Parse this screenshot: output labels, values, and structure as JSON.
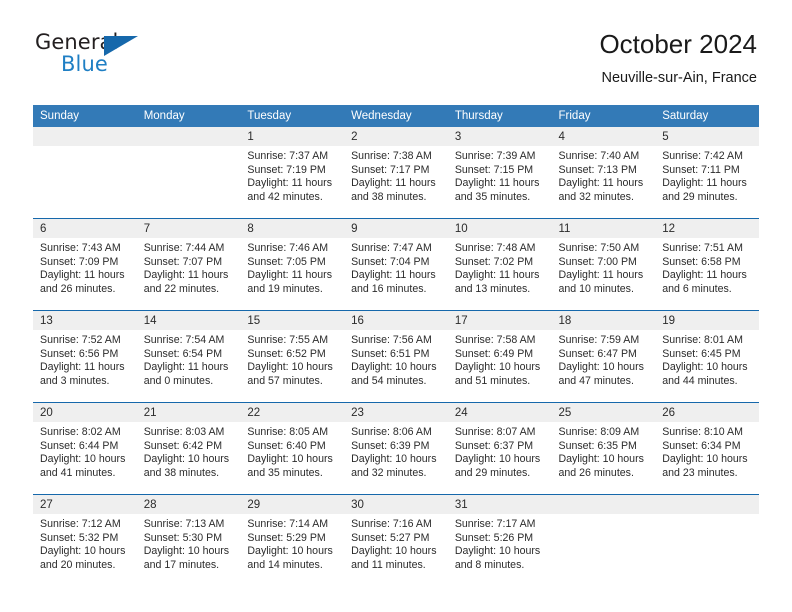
{
  "brand": {
    "name_part1": "General",
    "name_part2": "Blue",
    "logo_icon": "triangle-logo-icon",
    "accent_color": "#1668ab"
  },
  "header": {
    "title": "October 2024",
    "subtitle": "Neuville-sur-Ain, France",
    "header_bg_color": "#337ab7",
    "row_divider_color": "#1668ab",
    "daynum_band_color": "#efefef"
  },
  "weekday_headers": [
    "Sunday",
    "Monday",
    "Tuesday",
    "Wednesday",
    "Thursday",
    "Friday",
    "Saturday"
  ],
  "labels": {
    "sunrise_prefix": "Sunrise:",
    "sunset_prefix": "Sunset:",
    "daylight_prefix": "Daylight:"
  },
  "weeks": [
    [
      {
        "day": "",
        "empty": true
      },
      {
        "day": "",
        "empty": true
      },
      {
        "day": "1",
        "sunrise": "Sunrise: 7:37 AM",
        "sunset": "Sunset: 7:19 PM",
        "daylight_line1": "Daylight: 11 hours",
        "daylight_line2": "and 42 minutes."
      },
      {
        "day": "2",
        "sunrise": "Sunrise: 7:38 AM",
        "sunset": "Sunset: 7:17 PM",
        "daylight_line1": "Daylight: 11 hours",
        "daylight_line2": "and 38 minutes."
      },
      {
        "day": "3",
        "sunrise": "Sunrise: 7:39 AM",
        "sunset": "Sunset: 7:15 PM",
        "daylight_line1": "Daylight: 11 hours",
        "daylight_line2": "and 35 minutes."
      },
      {
        "day": "4",
        "sunrise": "Sunrise: 7:40 AM",
        "sunset": "Sunset: 7:13 PM",
        "daylight_line1": "Daylight: 11 hours",
        "daylight_line2": "and 32 minutes."
      },
      {
        "day": "5",
        "sunrise": "Sunrise: 7:42 AM",
        "sunset": "Sunset: 7:11 PM",
        "daylight_line1": "Daylight: 11 hours",
        "daylight_line2": "and 29 minutes."
      }
    ],
    [
      {
        "day": "6",
        "sunrise": "Sunrise: 7:43 AM",
        "sunset": "Sunset: 7:09 PM",
        "daylight_line1": "Daylight: 11 hours",
        "daylight_line2": "and 26 minutes."
      },
      {
        "day": "7",
        "sunrise": "Sunrise: 7:44 AM",
        "sunset": "Sunset: 7:07 PM",
        "daylight_line1": "Daylight: 11 hours",
        "daylight_line2": "and 22 minutes."
      },
      {
        "day": "8",
        "sunrise": "Sunrise: 7:46 AM",
        "sunset": "Sunset: 7:05 PM",
        "daylight_line1": "Daylight: 11 hours",
        "daylight_line2": "and 19 minutes."
      },
      {
        "day": "9",
        "sunrise": "Sunrise: 7:47 AM",
        "sunset": "Sunset: 7:04 PM",
        "daylight_line1": "Daylight: 11 hours",
        "daylight_line2": "and 16 minutes."
      },
      {
        "day": "10",
        "sunrise": "Sunrise: 7:48 AM",
        "sunset": "Sunset: 7:02 PM",
        "daylight_line1": "Daylight: 11 hours",
        "daylight_line2": "and 13 minutes."
      },
      {
        "day": "11",
        "sunrise": "Sunrise: 7:50 AM",
        "sunset": "Sunset: 7:00 PM",
        "daylight_line1": "Daylight: 11 hours",
        "daylight_line2": "and 10 minutes."
      },
      {
        "day": "12",
        "sunrise": "Sunrise: 7:51 AM",
        "sunset": "Sunset: 6:58 PM",
        "daylight_line1": "Daylight: 11 hours",
        "daylight_line2": "and 6 minutes."
      }
    ],
    [
      {
        "day": "13",
        "sunrise": "Sunrise: 7:52 AM",
        "sunset": "Sunset: 6:56 PM",
        "daylight_line1": "Daylight: 11 hours",
        "daylight_line2": "and 3 minutes."
      },
      {
        "day": "14",
        "sunrise": "Sunrise: 7:54 AM",
        "sunset": "Sunset: 6:54 PM",
        "daylight_line1": "Daylight: 11 hours",
        "daylight_line2": "and 0 minutes."
      },
      {
        "day": "15",
        "sunrise": "Sunrise: 7:55 AM",
        "sunset": "Sunset: 6:52 PM",
        "daylight_line1": "Daylight: 10 hours",
        "daylight_line2": "and 57 minutes."
      },
      {
        "day": "16",
        "sunrise": "Sunrise: 7:56 AM",
        "sunset": "Sunset: 6:51 PM",
        "daylight_line1": "Daylight: 10 hours",
        "daylight_line2": "and 54 minutes."
      },
      {
        "day": "17",
        "sunrise": "Sunrise: 7:58 AM",
        "sunset": "Sunset: 6:49 PM",
        "daylight_line1": "Daylight: 10 hours",
        "daylight_line2": "and 51 minutes."
      },
      {
        "day": "18",
        "sunrise": "Sunrise: 7:59 AM",
        "sunset": "Sunset: 6:47 PM",
        "daylight_line1": "Daylight: 10 hours",
        "daylight_line2": "and 47 minutes."
      },
      {
        "day": "19",
        "sunrise": "Sunrise: 8:01 AM",
        "sunset": "Sunset: 6:45 PM",
        "daylight_line1": "Daylight: 10 hours",
        "daylight_line2": "and 44 minutes."
      }
    ],
    [
      {
        "day": "20",
        "sunrise": "Sunrise: 8:02 AM",
        "sunset": "Sunset: 6:44 PM",
        "daylight_line1": "Daylight: 10 hours",
        "daylight_line2": "and 41 minutes."
      },
      {
        "day": "21",
        "sunrise": "Sunrise: 8:03 AM",
        "sunset": "Sunset: 6:42 PM",
        "daylight_line1": "Daylight: 10 hours",
        "daylight_line2": "and 38 minutes."
      },
      {
        "day": "22",
        "sunrise": "Sunrise: 8:05 AM",
        "sunset": "Sunset: 6:40 PM",
        "daylight_line1": "Daylight: 10 hours",
        "daylight_line2": "and 35 minutes."
      },
      {
        "day": "23",
        "sunrise": "Sunrise: 8:06 AM",
        "sunset": "Sunset: 6:39 PM",
        "daylight_line1": "Daylight: 10 hours",
        "daylight_line2": "and 32 minutes."
      },
      {
        "day": "24",
        "sunrise": "Sunrise: 8:07 AM",
        "sunset": "Sunset: 6:37 PM",
        "daylight_line1": "Daylight: 10 hours",
        "daylight_line2": "and 29 minutes."
      },
      {
        "day": "25",
        "sunrise": "Sunrise: 8:09 AM",
        "sunset": "Sunset: 6:35 PM",
        "daylight_line1": "Daylight: 10 hours",
        "daylight_line2": "and 26 minutes."
      },
      {
        "day": "26",
        "sunrise": "Sunrise: 8:10 AM",
        "sunset": "Sunset: 6:34 PM",
        "daylight_line1": "Daylight: 10 hours",
        "daylight_line2": "and 23 minutes."
      }
    ],
    [
      {
        "day": "27",
        "sunrise": "Sunrise: 7:12 AM",
        "sunset": "Sunset: 5:32 PM",
        "daylight_line1": "Daylight: 10 hours",
        "daylight_line2": "and 20 minutes."
      },
      {
        "day": "28",
        "sunrise": "Sunrise: 7:13 AM",
        "sunset": "Sunset: 5:30 PM",
        "daylight_line1": "Daylight: 10 hours",
        "daylight_line2": "and 17 minutes."
      },
      {
        "day": "29",
        "sunrise": "Sunrise: 7:14 AM",
        "sunset": "Sunset: 5:29 PM",
        "daylight_line1": "Daylight: 10 hours",
        "daylight_line2": "and 14 minutes."
      },
      {
        "day": "30",
        "sunrise": "Sunrise: 7:16 AM",
        "sunset": "Sunset: 5:27 PM",
        "daylight_line1": "Daylight: 10 hours",
        "daylight_line2": "and 11 minutes."
      },
      {
        "day": "31",
        "sunrise": "Sunrise: 7:17 AM",
        "sunset": "Sunset: 5:26 PM",
        "daylight_line1": "Daylight: 10 hours",
        "daylight_line2": "and 8 minutes."
      },
      {
        "day": "",
        "empty": true
      },
      {
        "day": "",
        "empty": true
      }
    ]
  ]
}
